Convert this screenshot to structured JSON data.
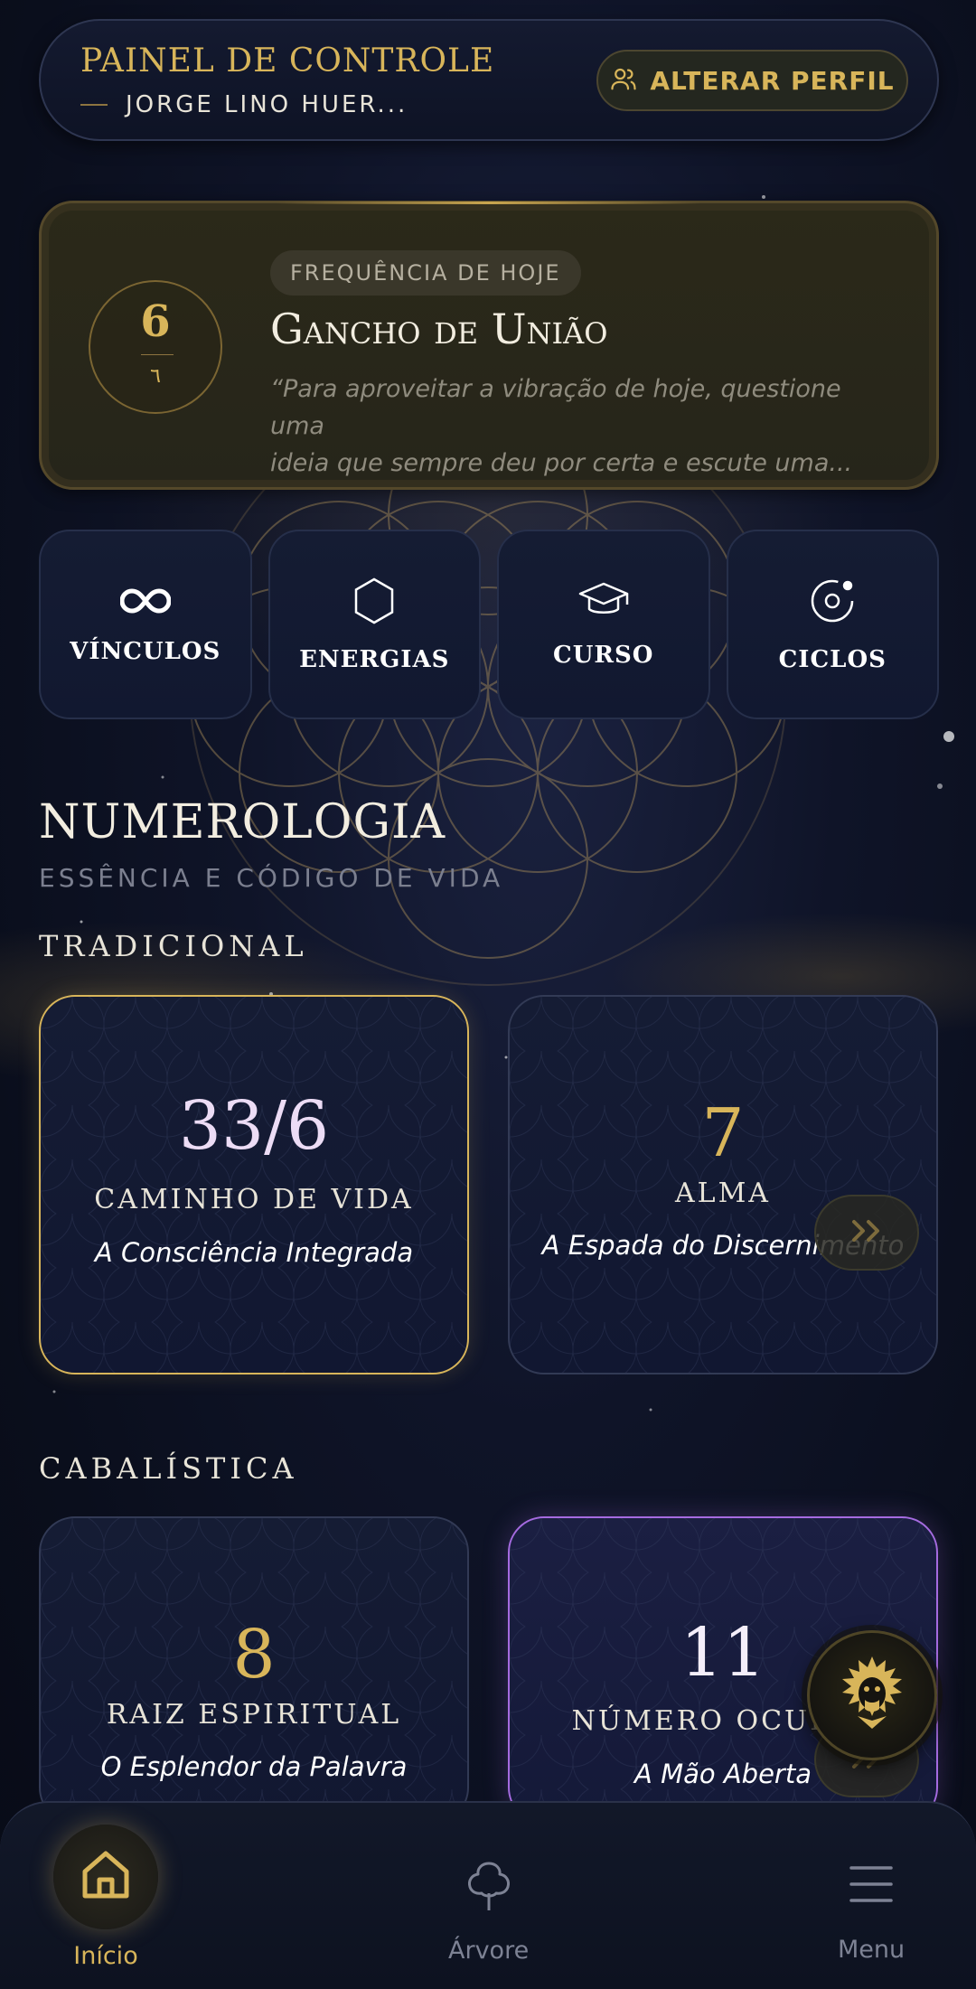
{
  "header": {
    "title": "PAINEL DE CONTROLE",
    "user_name": "JORGE LINO HUER...",
    "profile_button": "ALTERAR PERFIL"
  },
  "frequency": {
    "number": "6",
    "sub_number": "٦",
    "pill": "FREQUÊNCIA DE HOJE",
    "title": "Gancho de União",
    "quote_line1": "“Para aproveitar a vibração de hoje, questione uma",
    "quote_line2": "ideia que sempre deu por certa e escute uma..."
  },
  "tiles": [
    {
      "label": "VÍNCULOS",
      "icon": "infinity-icon"
    },
    {
      "label": "ENERGIAS",
      "icon": "hexagon-icon"
    },
    {
      "label": "CURSO",
      "icon": "graduation-cap-icon"
    },
    {
      "label": "CICLOS",
      "icon": "orbit-icon"
    }
  ],
  "numerology": {
    "title": "NUMEROLOGIA",
    "subtitle": "ESSÊNCIA E CÓDIGO DE VIDA",
    "traditional_label": "TRADICIONAL",
    "kabbalistic_label": "CABALÍSTICA",
    "traditional": [
      {
        "number": "33/6",
        "label": "CAMINHO DE VIDA",
        "desc": "A Consciência Integrada"
      },
      {
        "number": "7",
        "label": "ALMA",
        "desc": "A Espada do Discernimento"
      }
    ],
    "kabbalistic": [
      {
        "number": "8",
        "label": "RAIZ ESPIRITUAL",
        "desc": "O Esplendor da Palavra"
      },
      {
        "number": "11",
        "label": "NÚMERO OCULTO",
        "desc": "A Mão Aberta"
      }
    ]
  },
  "fab": {
    "icon": "spirit-guide-icon"
  },
  "nav": {
    "home": "Início",
    "tree": "Árvore",
    "menu": "Menu"
  },
  "colors": {
    "gold": "#d8b55a",
    "background": "#0f1428",
    "purple_accent": "#a56be0"
  }
}
